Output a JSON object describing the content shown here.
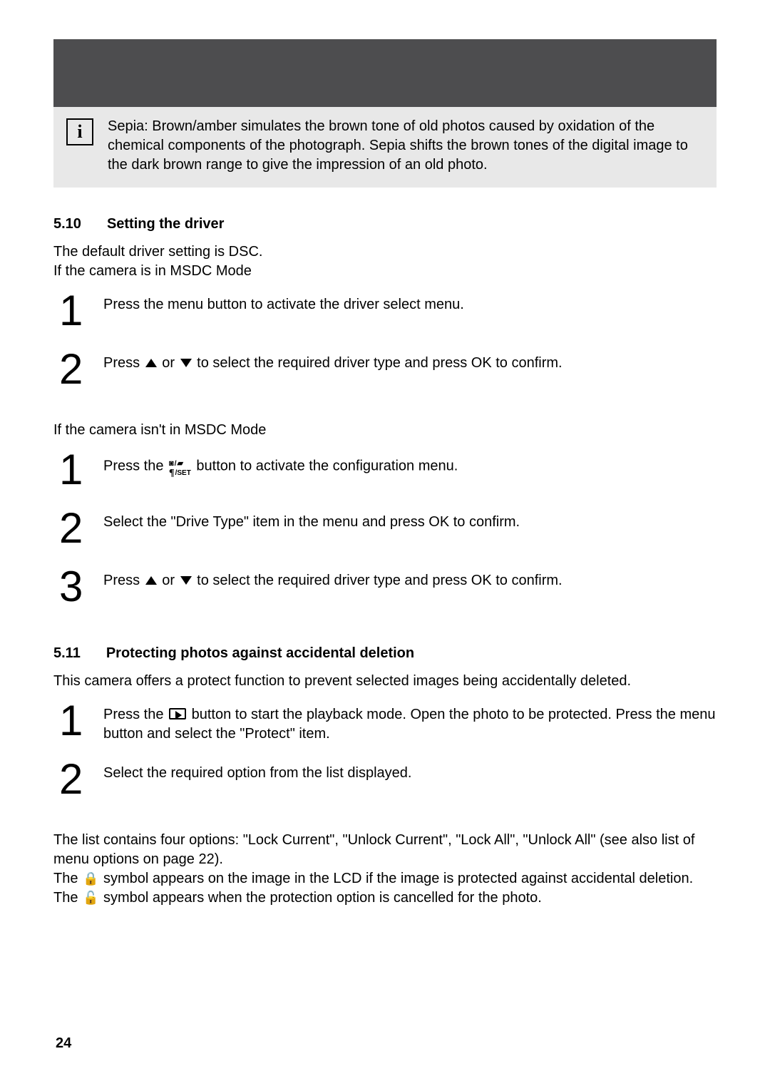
{
  "info_box": {
    "text": "Sepia: Brown/amber simulates the brown tone of old photos caused by oxidation of the chemical components of the photograph. Sepia shifts the brown tones of the digital image to the dark brown range to give the impression of an old photo."
  },
  "section_510": {
    "number": "5.10",
    "title": "Setting the driver",
    "intro_line1": "The default driver setting is DSC.",
    "intro_line2": "If the camera is in MSDC Mode",
    "msdc_step1": "Press the menu button to activate the driver select menu.",
    "msdc_step2_a": "Press ",
    "msdc_step2_b": " or ",
    "msdc_step2_c": " to select the required driver type and press OK to confirm.",
    "not_msdc_intro": "If the camera isn't in MSDC Mode",
    "nm_step1_a": "Press the ",
    "nm_step1_b": " button to activate the configuration menu.",
    "nm_step2": "Select the \"Drive Type\" item in the menu and press OK to confirm.",
    "nm_step3_a": "Press ",
    "nm_step3_b": " or ",
    "nm_step3_c": " to select the required driver type and press OK to confirm."
  },
  "section_511": {
    "number": "5.11",
    "title": "Protecting photos against accidental deletion",
    "intro": "This camera offers a protect function to prevent selected images being accidentally deleted.",
    "step1_a": "Press the ",
    "step1_b": " button to start the playback mode. Open the photo to be protected. Press the menu button and select the \"Protect\" item.",
    "step2": "Select the required option from the list displayed.",
    "footer_1": "The list contains four options: \"Lock Current\", \"Unlock Current\", \"Lock All\", \"Unlock All\" (see also list of menu options on page 22).",
    "footer_2a": "The ",
    "footer_2b": " symbol appears on the image in the LCD if the image is protected against accidental deletion. The ",
    "footer_2c": " symbol appears when the protection option is cancelled for the photo."
  },
  "nums": {
    "n1": "1",
    "n2": "2",
    "n3": "3"
  },
  "icons": {
    "set_top": "◘ / ◘",
    "set_label": "/SET"
  },
  "page_number": "24"
}
